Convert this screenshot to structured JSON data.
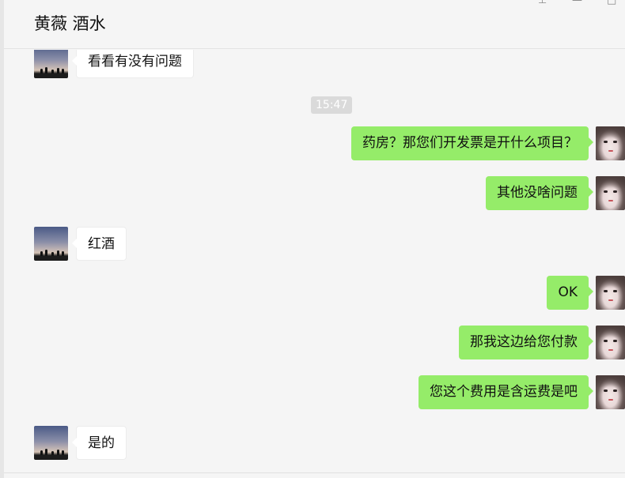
{
  "header": {
    "title": "黄薇 酒水",
    "pin_icon": "⊥",
    "minimize_icon": "—",
    "maximize_icon": "□"
  },
  "chat": {
    "timestamp": "15:47",
    "messages": [
      {
        "side": "left",
        "text": "看看有没有问题"
      },
      {
        "side": "right",
        "text": "药房？那您们开发票是开什么项目？"
      },
      {
        "side": "right",
        "text": "其他没啥问题"
      },
      {
        "side": "left",
        "text": "红酒"
      },
      {
        "side": "right",
        "text": "OK"
      },
      {
        "side": "right",
        "text": "那我这边给您付款"
      },
      {
        "side": "right",
        "text": "您这个费用是含运费是吧"
      },
      {
        "side": "left",
        "text": "是的"
      }
    ]
  },
  "colors": {
    "sent_bubble": "#95ec69",
    "received_bubble": "#ffffff",
    "background": "#f5f5f5"
  }
}
